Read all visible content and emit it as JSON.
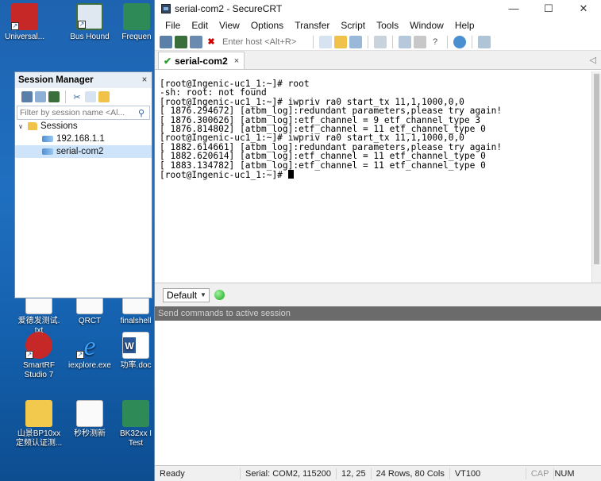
{
  "desktop": {
    "icons": [
      {
        "label": "Universal..."
      },
      {
        "label": "Bus Hound"
      },
      {
        "label": "Frequen"
      },
      {
        "label": "爱德发测试.\ntxt"
      },
      {
        "label": "QRCT"
      },
      {
        "label": "finalshell"
      },
      {
        "label": "SmartRF\nStudio 7"
      },
      {
        "label": "iexplore.exe"
      },
      {
        "label": "功率.doc"
      },
      {
        "label": "山景BP10xx\n定频认证测..."
      },
      {
        "label": "秒秒测新"
      },
      {
        "label": "BK32xx I\nTest"
      }
    ]
  },
  "window": {
    "title": "serial-com2 - SecureCRT",
    "controls": {
      "minimize": "—",
      "maximize": "☐",
      "close": "✕"
    },
    "menu": [
      "File",
      "Edit",
      "View",
      "Options",
      "Transfer",
      "Script",
      "Tools",
      "Window",
      "Help"
    ],
    "toolbar": {
      "host_placeholder": "Enter host <Alt+R>"
    },
    "tab": {
      "label": "serial-com2",
      "close": "×",
      "scroll": "◁"
    }
  },
  "terminal": {
    "lines": [
      "[root@Ingenic-uc1_1:~]# root",
      "-sh: root: not found",
      "[root@Ingenic-uc1_1:~]# iwpriv ra0 start_tx 11,1,1000,0,0",
      "[ 1876.294672] [atbm_log]:redundant parameters,please try again!",
      "[ 1876.300626] [atbm_log]:etf_channel = 9 etf_channel_type 3",
      "[ 1876.814802] [atbm_log]:etf_channel = 11 etf_channel_type 0",
      "[root@Ingenic-uc1_1:~]# iwpriv ra0 start_tx 11,1,1000,0,0",
      "[ 1882.614661] [atbm_log]:redundant parameters,please try again!",
      "[ 1882.620614] [atbm_log]:etf_channel = 11 etf_channel_type 0",
      "[ 1883.134782] [atbm_log]:etf_channel = 11 etf_channel_type 0",
      "[root@Ingenic-uc1_1:~]# "
    ]
  },
  "command": {
    "target": "Default",
    "send_hint": "Send commands to active session"
  },
  "statusbar": {
    "ready": "Ready",
    "serial": "Serial: COM2, 115200",
    "position": "12, 25",
    "size": "24 Rows, 80 Cols",
    "emulation": "VT100",
    "cap": "CAP",
    "num": "NUM"
  },
  "session_manager": {
    "title": "Session Manager",
    "close": "×",
    "filter_placeholder": "Filter by session name <Al...",
    "tree": {
      "root": "Sessions",
      "items": [
        "192.168.1.1",
        "serial-com2"
      ]
    }
  },
  "colors": {
    "status_connected": "#18a818",
    "selected_row": "#cde4fa"
  }
}
